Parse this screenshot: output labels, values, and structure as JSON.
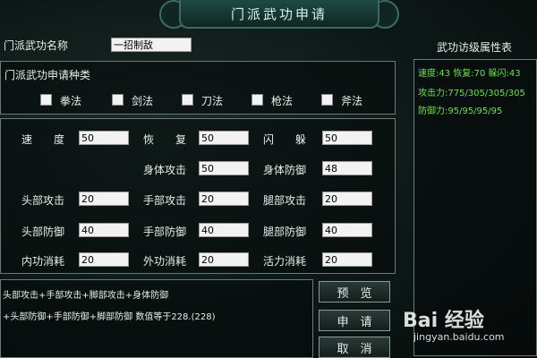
{
  "title": "门派武功申请",
  "name_field": {
    "label": "门派武功名称",
    "value": "一招制敌"
  },
  "attr_header": "武功访级属性表",
  "attr_lines": [
    "速度:43 恢复:70 躲闪:43",
    "攻击力:775/305/305/305",
    "防御力:95/95/95/95"
  ],
  "type_section": {
    "label": "门派武功申请种类",
    "options": [
      "拳法",
      "剑法",
      "刀法",
      "枪法",
      "斧法"
    ]
  },
  "stats": {
    "speed": {
      "label": "速　　度",
      "value": "50"
    },
    "recover": {
      "label": "恢　　复",
      "value": "50"
    },
    "dodge": {
      "label": "闪　　躲",
      "value": "50"
    },
    "body_atk": {
      "label": "身体攻击",
      "value": "50"
    },
    "body_def": {
      "label": "身体防御",
      "value": "48"
    },
    "head_atk": {
      "label": "头部攻击",
      "value": "20"
    },
    "hand_atk": {
      "label": "手部攻击",
      "value": "20"
    },
    "leg_atk": {
      "label": "腿部攻击",
      "value": "20"
    },
    "head_def": {
      "label": "头部防御",
      "value": "40"
    },
    "hand_def": {
      "label": "手部防御",
      "value": "40"
    },
    "leg_def": {
      "label": "腿部防御",
      "value": "40"
    },
    "inner": {
      "label": "内功消耗",
      "value": "20"
    },
    "outer": {
      "label": "外功消耗",
      "value": "20"
    },
    "vital": {
      "label": "活力消耗",
      "value": "20"
    }
  },
  "formula": {
    "line1": "头部攻击+手部攻击+脚部攻击+身体防御",
    "line2": "+头部防御+手部防御+脚部防御 数值等于228.(228)"
  },
  "buttons": {
    "preview": "预　览",
    "apply": "申　请",
    "cancel": "取　消"
  },
  "watermark": {
    "brand": "Bai 经验",
    "url": "jingyan.baidu.com"
  }
}
